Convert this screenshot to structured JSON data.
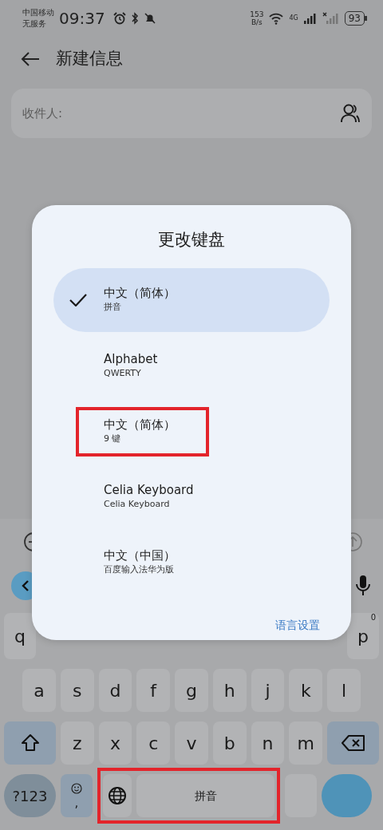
{
  "status_bar": {
    "carrier": "中国移动",
    "service": "无服务",
    "time": "09:37",
    "speed_value": "153",
    "speed_unit": "B/s",
    "network": "4G",
    "battery": "93"
  },
  "header": {
    "title": "新建信息"
  },
  "recipient_field": {
    "placeholder": "收件人:"
  },
  "dialog": {
    "title": "更改键盘",
    "options": [
      {
        "name": "中文（简体）",
        "detail": "拼音",
        "selected": true,
        "highlighted": false
      },
      {
        "name": "Alphabet",
        "detail": "QWERTY",
        "selected": false,
        "highlighted": false
      },
      {
        "name": "中文（简体）",
        "detail": "9 键",
        "selected": false,
        "highlighted": true
      },
      {
        "name": "Celia Keyboard",
        "detail": "Celia Keyboard",
        "selected": false,
        "highlighted": false
      },
      {
        "name": "中文（中国）",
        "detail": "百度输入法华为版",
        "selected": false,
        "highlighted": false
      }
    ],
    "link": "语言设置"
  },
  "keyboard": {
    "rows": [
      {
        "kind": "edge",
        "keys": [
          {
            "kind": "letter",
            "label": "q"
          },
          {
            "kind": "letter",
            "label": "p",
            "hint": "0"
          }
        ]
      },
      {
        "kind": "full",
        "keys": [
          {
            "kind": "letter",
            "label": "a"
          },
          {
            "kind": "letter",
            "label": "s"
          },
          {
            "kind": "letter",
            "label": "d"
          },
          {
            "kind": "letter",
            "label": "f"
          },
          {
            "kind": "letter",
            "label": "g"
          },
          {
            "kind": "letter",
            "label": "h"
          },
          {
            "kind": "letter",
            "label": "j"
          },
          {
            "kind": "letter",
            "label": "k"
          },
          {
            "kind": "letter",
            "label": "l"
          }
        ]
      },
      {
        "kind": "full",
        "keys": [
          {
            "kind": "shift"
          },
          {
            "kind": "letter",
            "label": "z"
          },
          {
            "kind": "letter",
            "label": "x"
          },
          {
            "kind": "letter",
            "label": "c"
          },
          {
            "kind": "letter",
            "label": "v"
          },
          {
            "kind": "letter",
            "label": "b"
          },
          {
            "kind": "letter",
            "label": "n"
          },
          {
            "kind": "letter",
            "label": "m"
          },
          {
            "kind": "backspace"
          }
        ]
      },
      {
        "kind": "full",
        "keys": [
          {
            "kind": "symbols",
            "label": "?123"
          },
          {
            "kind": "emoji",
            "label": ","
          },
          {
            "kind": "group",
            "highlighted": true,
            "keys": [
              {
                "kind": "globe"
              },
              {
                "kind": "space",
                "label": "拼音"
              }
            ]
          },
          {
            "kind": "plain"
          },
          {
            "kind": "action"
          }
        ]
      }
    ]
  }
}
